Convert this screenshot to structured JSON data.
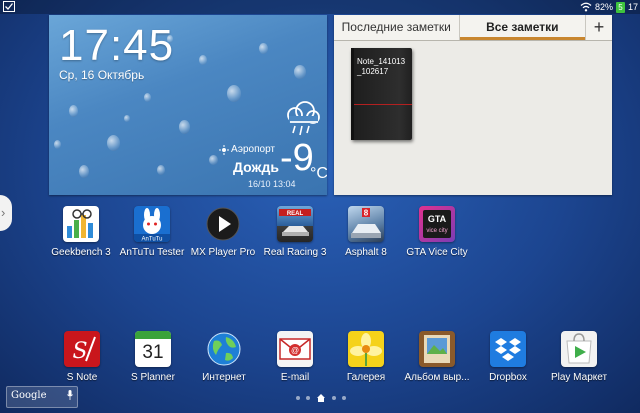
{
  "status_bar": {
    "battery_percent": "82%",
    "battery_glyph": "5",
    "time_partial": "17"
  },
  "weather_widget": {
    "time": "17:45",
    "date": "Ср, 16 Октябрь",
    "location": "Аэропорт",
    "condition": "Дождь",
    "temperature": "-9",
    "unit": "°C",
    "updated": "16/10 13:04",
    "icon": "rain-cloud-icon"
  },
  "notes_widget": {
    "tabs": [
      "Последние заметки",
      "Все заметки"
    ],
    "active_tab": "Все заметки",
    "add_label": "+",
    "note_title": "Note_141013\n_102617",
    "accent_color": "#c8862f"
  },
  "apps_row1": [
    {
      "label": "Geekbench 3",
      "icon": "geekbench-icon"
    },
    {
      "label": "AnTuTu Tester",
      "icon": "antutu-icon"
    },
    {
      "label": "MX Player Pro",
      "icon": "mx-player-icon"
    },
    {
      "label": "Real Racing 3",
      "icon": "real-racing-icon"
    },
    {
      "label": "Asphalt 8",
      "icon": "asphalt-icon"
    },
    {
      "label": "GTA Vice City",
      "icon": "gta-icon"
    }
  ],
  "dock_apps": [
    {
      "label": "S Note",
      "icon": "s-note-icon"
    },
    {
      "label": "S Planner",
      "icon": "calendar-icon",
      "day": "31"
    },
    {
      "label": "Интернет",
      "icon": "globe-icon"
    },
    {
      "label": "E-mail",
      "icon": "email-icon"
    },
    {
      "label": "Галерея",
      "icon": "gallery-icon"
    },
    {
      "label": "Альбом выр...",
      "icon": "album-icon"
    },
    {
      "label": "Dropbox",
      "icon": "dropbox-icon"
    },
    {
      "label": "Play Маркет",
      "icon": "play-store-icon"
    }
  ],
  "search": {
    "label": "Google"
  }
}
